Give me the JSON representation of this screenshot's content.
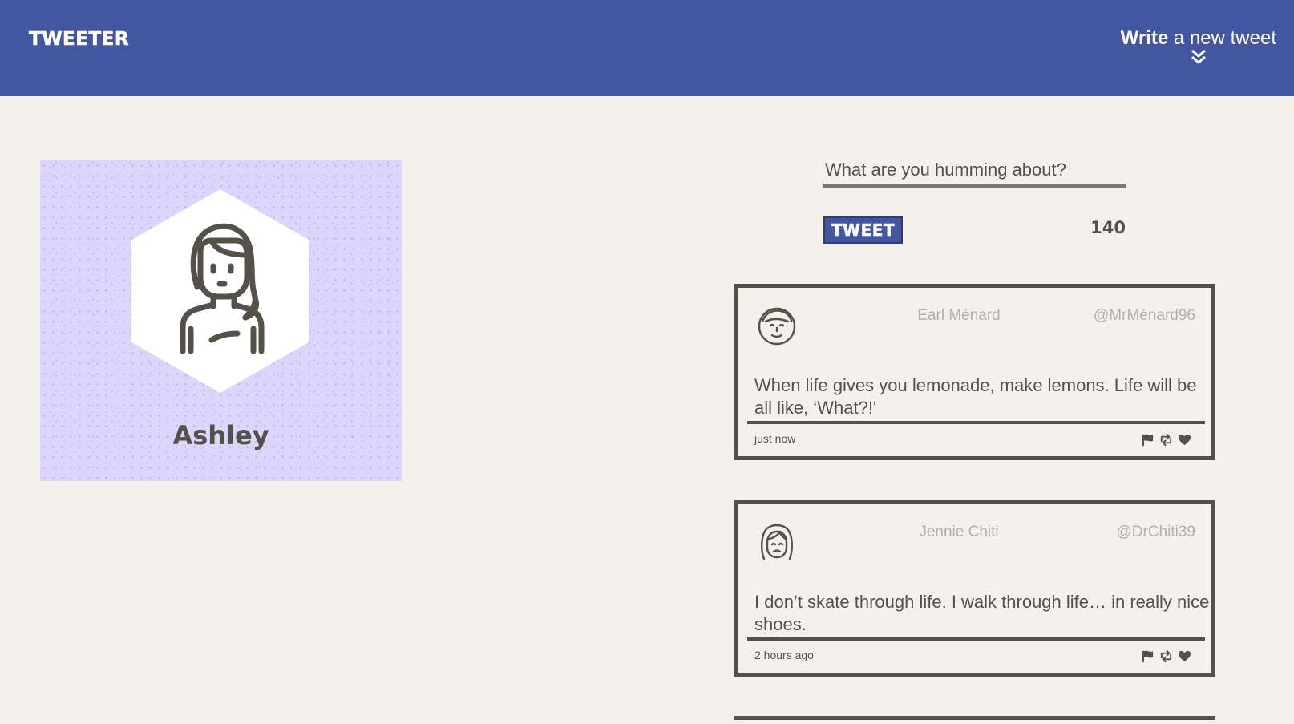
{
  "nav": {
    "brand": "TWEETER",
    "compose_strong": "Write",
    "compose_rest": " a new tweet",
    "compose_icon": "double-chevron-down-icon"
  },
  "colors": {
    "nav_bg": "#4356a2",
    "page_bg": "#f4f1ec",
    "profile_bg": "#ddd6fc",
    "text": "#545149",
    "muted_text": "#b3b0a9"
  },
  "profile": {
    "name": "Ashley",
    "avatar_icon": "woman-avatar-icon"
  },
  "composer": {
    "placeholder": "What are you humming about?",
    "button_label": "TWEET",
    "char_count": "140"
  },
  "tweets": [
    {
      "name": "Earl Ménard",
      "handle": "@MrMénard96",
      "text": "When life gives you lemonade, make lemons. Life will be all like, ‘What?!'",
      "time": "just now",
      "avatar_icon": "man-avatar-icon"
    },
    {
      "name": "Jennie Chiti",
      "handle": "@DrChiti39",
      "text": "I don’t skate through life. I walk through life… in really nice shoes.",
      "time": "2 hours ago",
      "avatar_icon": "woman-avatar-icon"
    }
  ],
  "tweet_actions": [
    "flag-icon",
    "retweet-icon",
    "heart-icon"
  ]
}
